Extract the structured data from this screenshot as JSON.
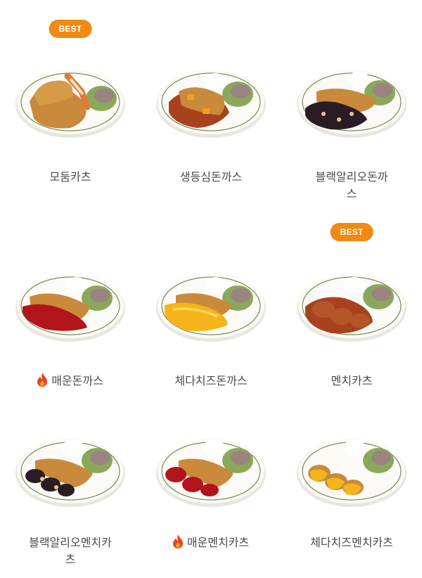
{
  "badge_label": "BEST",
  "menu": [
    {
      "name": "모둠카츠",
      "best": true,
      "spicy": false,
      "style": "mixed"
    },
    {
      "name": "생등심돈까스",
      "best": false,
      "spicy": false,
      "style": "sauce"
    },
    {
      "name": "블랙알리오돈까스",
      "best": false,
      "spicy": false,
      "style": "black"
    },
    {
      "name": "매운돈까스",
      "best": false,
      "spicy": true,
      "style": "red"
    },
    {
      "name": "체다치즈돈까스",
      "best": false,
      "spicy": false,
      "style": "cheese"
    },
    {
      "name": "멘치카츠",
      "best": true,
      "spicy": false,
      "style": "menchi"
    },
    {
      "name": "블랙알리오멘치카츠",
      "best": false,
      "spicy": false,
      "style": "black-menchi"
    },
    {
      "name": "매운멘치카츠",
      "best": false,
      "spicy": true,
      "style": "red-menchi"
    },
    {
      "name": "체다치즈멘치카츠",
      "best": false,
      "spicy": false,
      "style": "cheese-menchi"
    }
  ],
  "colors": {
    "badge": "#f08a14",
    "fire": "#e8431c",
    "cutlet": "#c98a3c",
    "demiglace": "#a8421e",
    "spicy_sauce": "#b3141c",
    "black_sauce": "#2a1c24",
    "cheese": "#f6b41a"
  }
}
